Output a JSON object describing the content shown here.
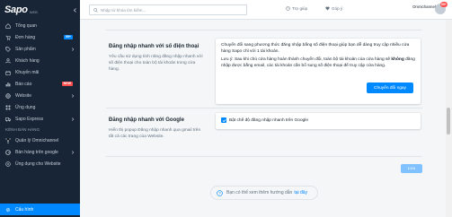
{
  "brand": {
    "name": "Sapo",
    "sub": "WEB"
  },
  "sidebar": {
    "items": [
      {
        "label": "Tổng quan",
        "icon": "home-icon"
      },
      {
        "label": "Đơn hàng",
        "icon": "cart-icon",
        "badge": "99+"
      },
      {
        "label": "Sản phẩm",
        "icon": "tag-icon",
        "chevron": true
      },
      {
        "label": "Khách hàng",
        "icon": "user-icon"
      },
      {
        "label": "Khuyến mãi",
        "icon": "gift-icon"
      },
      {
        "label": "Báo cáo",
        "icon": "chart-icon",
        "badge": "NEW"
      },
      {
        "label": "Website",
        "icon": "globe-icon",
        "chevron": true
      },
      {
        "label": "Ứng dụng",
        "icon": "apps-icon"
      },
      {
        "label": "Sapo Express",
        "icon": "truck-icon",
        "chevron": true
      }
    ],
    "sales_section_title": "KÊNH BÁN HÀNG",
    "sales_items": [
      {
        "label": "Quản lý Omnichannel",
        "icon": "omnichannel-icon"
      },
      {
        "label": "Bán hàng trên google",
        "icon": "google-icon",
        "chevron": true
      },
      {
        "label": "Ủng dụng cho Website",
        "icon": "plus-icon"
      }
    ],
    "settings_label": "Cấu hình"
  },
  "topbar": {
    "search_placeholder": "Nhập từ khóa tìm kiếm...",
    "help_label": "Trợ giúp",
    "feedback_label": "Góp ý",
    "user_name": "Omnichannel",
    "user_sub": "",
    "notification_count": "99+"
  },
  "phone_login": {
    "title": "Đăng nhập nhanh với số điện thoại",
    "description": "Yêu cầu sử dụng tính năng đăng nhập nhanh với số điện thoại cho toàn bộ tài khoản trong cửa hàng.",
    "card_text_1": "Chuyển đổi sang phương thức đăng nhập bằng số điện thoại giúp bạn dễ dàng truy cập nhiều cửa hàng Sapo chỉ với 1 tài khoản.",
    "card_text_2_prefix": "Lưu ý: Sau khi chủ cửa hàng hoàn thành chuyển đổi, toàn bộ tài khoản của cửa hàng sẽ ",
    "card_text_2_bold": "không",
    "card_text_2_suffix": " đăng nhập được bằng email, các tài khoản cần bổ sung số điện thoại để truy cập cửa hàng.",
    "button_label": "Chuyển đổi ngay"
  },
  "google_login": {
    "title": "Đăng nhập nhanh với Google",
    "description": "Hiển thị popup Đăng nhập nhanh qua gmail trên tất cả các trang của Website.",
    "checkbox_label": "Bật chế độ đăng nhập nhanh trên Google",
    "checked": true
  },
  "save_label": "Lưu",
  "help_box": {
    "text": "Bạn có thể xem thêm hướng dẫn",
    "link": "tại đây"
  },
  "colors": {
    "primary": "#0088ff",
    "sidebar": "#182537",
    "badge_red": "#ff4d4d"
  }
}
